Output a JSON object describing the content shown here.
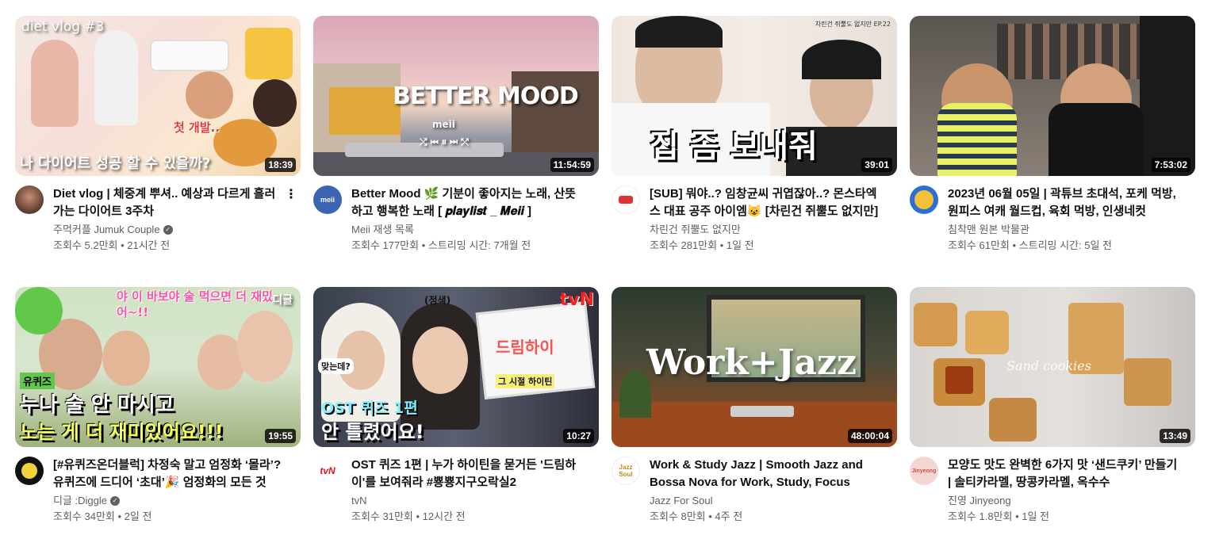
{
  "videos": [
    {
      "thumb_text_top": "diet vlog #3",
      "thumb_text_main": "나 다이어트 성공 할 수 있을까?",
      "thumb_text_side": "첫 개발..",
      "duration": "18:39",
      "title": "Diet vlog | 체중계 뿌셔.. 예상과 다르게 흘러가는 다이어트 3주차",
      "channel": "주먹커플 Jumuk Couple",
      "verified": true,
      "stats": "조회수 5.2만회 • 21시간 전"
    },
    {
      "thumb_text_main": "BETTER MOOD",
      "thumb_text_sub": "meii",
      "duration": "11:54:59",
      "title": "Better Mood 🌿 기분이 좋아지는 노래, 산뜻하고 행복한 노래 [ 𝒑𝒍𝒂𝒚𝒍𝒊𝒔𝒕 _ 𝑴𝒆𝒊𝒊 ]",
      "channel": "Meii 재생 목록",
      "avatar_text": "meii",
      "stats": "조회수 177만회 • 스트리밍 시간: 7개월 전"
    },
    {
      "thumb_text_top": "차린건 쥐뿔도 없지만 EP.22",
      "thumb_text_main": "집 좀 보내줘",
      "duration": "39:01",
      "title": "[SUB] 뭐야..? 임창균씨 귀엽잖아..? 몬스타엑스 대표 공주 아이엠😺 [차린건 쥐뿔도 없지만]",
      "channel": "차린건 쥐뿔도 없지만",
      "stats": "조회수 281만회 • 1일 전"
    },
    {
      "duration": "7:53:02",
      "title": "2023년 06월 05일 | 곽튜브 초대석, 포케 먹방, 원피스 여캐 월드컵, 육회 먹방, 인생네컷",
      "channel": "침착맨 원본 박물관",
      "stats": "조회수 61만회 • 스트리밍 시간: 5일 전"
    },
    {
      "thumb_text_top": "야 이 바보야 술 먹으면 더 재밌어~!!",
      "thumb_text_corner": "디글",
      "thumb_text_tag": "유퀴즈",
      "thumb_text_main": "누나 술 안 마시고",
      "thumb_text_main2": "노는 게 더 재미있어요!!!",
      "duration": "19:55",
      "title": "[#유퀴즈온더블럭] 차정숙 말고 엄정화 ‘몰라’? 유퀴즈에 드디어 ‘초대’🎉 엄정화의 모든 것",
      "channel": "디글 :Diggle",
      "verified": true,
      "stats": "조회수 34만회 • 2일 전"
    },
    {
      "thumb_text_top": "(정색)",
      "thumb_text_brand": "tvN",
      "thumb_text_side": "드림하이",
      "thumb_text_side2": "그 시절 하이틴",
      "thumb_text_q": "맞는데?",
      "thumb_text_main": "OST 퀴즈 1편",
      "thumb_text_main2": "안 틀렸어요!",
      "duration": "10:27",
      "title": "OST 퀴즈 1편 | 누가 하이틴을 묻거든 '드림하이'를 보여줘라 #뿅뿅지구오락실2",
      "channel": "tvN",
      "avatar_text": "tvN",
      "stats": "조회수 31만회 • 12시간 전"
    },
    {
      "thumb_text_main": "Work+Jazz",
      "duration": "48:00:04",
      "title": "Work & Study Jazz | Smooth Jazz and Bossa Nova for Work, Study, Focus",
      "channel": "Jazz For Soul",
      "avatar_text": "Jazz Soul",
      "stats": "조회수 8만회 • 4주 전"
    },
    {
      "thumb_text_main": "Sand cookies",
      "duration": "13:49",
      "title": "모양도 맛도 완벽한 6가지 맛 ‘샌드쿠키’ 만들기 | 솔티카라멜, 땅콩카라멜, 옥수수",
      "channel": "진영 Jinyeong",
      "avatar_text": "Jinyeong",
      "stats": "조회수 1.8만회 • 1일 전"
    }
  ],
  "colors": {
    "title": "#0f0f0f",
    "secondary": "#606060",
    "duration_bg": "#000000"
  }
}
